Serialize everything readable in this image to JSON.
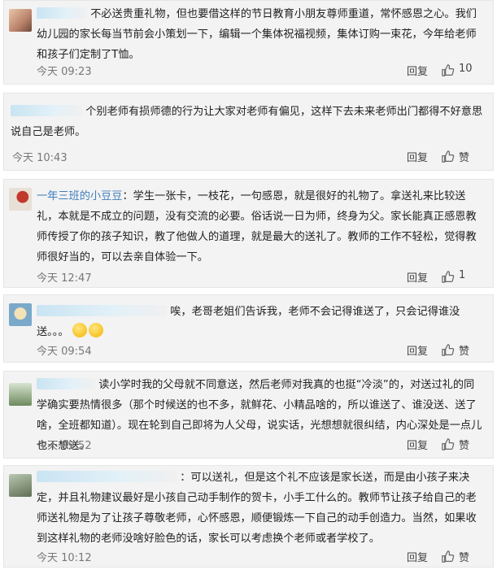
{
  "comments": [
    {
      "username": "",
      "text": "不必送贵重礼物，但也要借这样的节日教育小朋友尊师重道，常怀感恩之心。我们幼儿园的家长每当节前会小策划一下，编辑一个集体祝福视频，集体订购一束花，今年给老师和孩子们定制了T恤。",
      "time": "今天 09:23",
      "reply": "回复",
      "likes": "10"
    },
    {
      "username": "",
      "text": "个别老师有损师德的行为让大家对老师有偏见，这样下去未来老师出门都得不好意思说自己是老师。",
      "time": "今天 10:43",
      "reply": "回复",
      "likes": "赞"
    },
    {
      "username": "一年三班的小豆豆",
      "text": "：学生一张卡，一枝花，一句感恩，就是很好的礼物了。拿送礼来比较送礼，本就是不成立的问题，没有交流的必要。俗话说一日为师，终身为父。家长能真正感恩教师传授了你的孩子知识，教了他做人的道理，就是最大的送礼了。教师的工作不轻松，觉得教师很好当的，可以去亲自体验一下。",
      "time": "今天 12:47",
      "reply": "回复",
      "likes": "1"
    },
    {
      "username": "",
      "text": "唉，老哥老姐们告诉我，老师不会记得谁送了，只会记得谁没送。。。",
      "time": "今天 09:54",
      "reply": "回复",
      "likes": "赞"
    },
    {
      "username": "",
      "text": "读小学时我的父母就不同意送，然后老师对我真的也挺“冷淡”的，对送过礼的同学确实要热情很多（那个时候送的也不多，就鲜花、小精品啥的，所以谁送了、谁没送、送了啥，全班都知道）。现在轮到自己即将为人父母，说实话，光想想就很纠结，内心深处是一点儿也不想送。",
      "time": "今天 09:52",
      "reply": "回复",
      "likes": "赞"
    },
    {
      "username": "",
      "text": "：可以送礼，但是这个礼不应该是家长送，而是由小孩子来决定，并且礼物建议最好是小孩自己动手制作的贺卡，小手工什么的。教师节让孩子给自己的老师送礼物是为了让孩子尊敬老师，心怀感恩，顺便锻炼一下自己的动手创造力。当然，如果收到这样礼物的老师没啥好脸色的话，家长可以考虑换个老师或者学校了。",
      "time": "今天 10:12",
      "reply": "回复",
      "likes": "赞"
    }
  ],
  "icon": "thumbs-up-icon"
}
